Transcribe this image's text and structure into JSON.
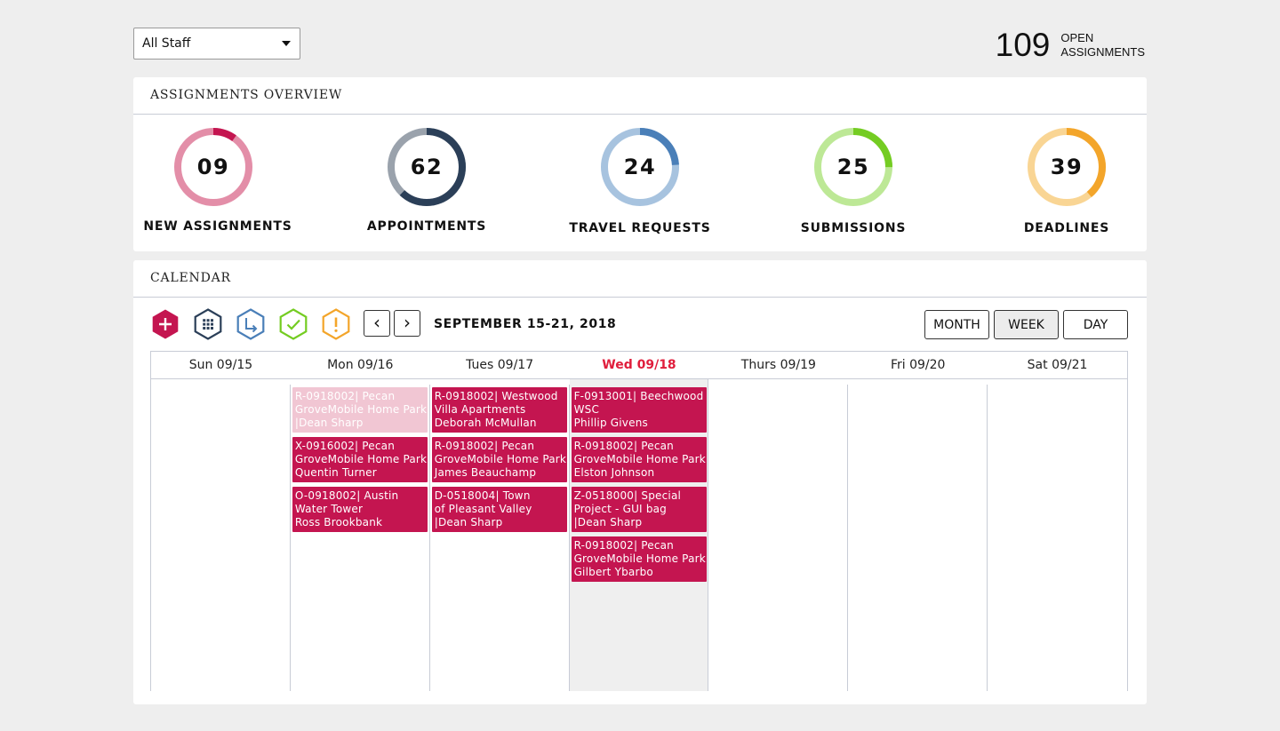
{
  "filter": {
    "selected": "All Staff"
  },
  "open_assignments": {
    "count": "109",
    "label_line1": "OPEN",
    "label_line2": "ASSIGNMENTS"
  },
  "overview": {
    "title": "ASSIGNMENTS OVERVIEW",
    "stats": [
      {
        "value": "09",
        "label": "NEW ASSIGNMENTS",
        "fraction": 0.1,
        "color": "#c41550",
        "track": "#e38ea8"
      },
      {
        "value": "62",
        "label": "APPOINTMENTS",
        "fraction": 0.62,
        "color": "#2b3f58",
        "track": "#9aa2ac"
      },
      {
        "value": "24",
        "label": "TRAVEL REQUESTS",
        "fraction": 0.24,
        "color": "#4a7fb8",
        "track": "#a7c3df"
      },
      {
        "value": "25",
        "label": "SUBMISSIONS",
        "fraction": 0.25,
        "color": "#74cc22",
        "track": "#bde896"
      },
      {
        "value": "39",
        "label": "DEADLINES",
        "fraction": 0.39,
        "color": "#f3a52a",
        "track": "#f9d594"
      }
    ]
  },
  "calendar": {
    "title": "CALENDAR",
    "tools": [
      {
        "icon": "add-icon",
        "color": "#c41550"
      },
      {
        "icon": "grid-icon",
        "color": "#2b3f58"
      },
      {
        "icon": "redirect-arrow-icon",
        "color": "#4a7fb8"
      },
      {
        "icon": "check-icon",
        "color": "#74cc22"
      },
      {
        "icon": "alert-icon",
        "color": "#f3a52a"
      }
    ],
    "prev": "‹",
    "next": "›",
    "range": "SEPTEMBER 15-21, 2018",
    "views": [
      "MONTH",
      "WEEK",
      "DAY"
    ],
    "active_view": "WEEK",
    "days": [
      "Sun 09/15",
      "Mon 09/16",
      "Tues 09/17",
      "Wed 09/18",
      "Thurs 09/19",
      "Fri 09/20",
      "Sat 09/21"
    ],
    "today_index": 3,
    "events": [
      [],
      [
        {
          "line1": "R-0918002| Pecan",
          "line2": "GroveMobile Home Park",
          "line3": "|Dean Sharp",
          "faded": true
        },
        {
          "line1": "X-0916002| Pecan",
          "line2": "GroveMobile Home Park",
          "line3": "Quentin Turner",
          "faded": false
        },
        {
          "line1": "O-0918002| Austin",
          "line2": "Water Tower",
          "line3": "Ross Brookbank",
          "faded": false
        }
      ],
      [
        {
          "line1": "R-0918002| Westwood",
          "line2": "Villa Apartments",
          "line3": "Deborah McMullan",
          "faded": false
        },
        {
          "line1": "R-0918002| Pecan",
          "line2": "GroveMobile Home Park",
          "line3": "James Beauchamp",
          "faded": false
        },
        {
          "line1": "D-0518004| Town",
          "line2": "of Pleasant Valley",
          "line3": "|Dean Sharp",
          "faded": false
        }
      ],
      [
        {
          "line1": "F-0913001| Beechwood",
          "line2": "WSC",
          "line3": "Phillip Givens",
          "faded": false
        },
        {
          "line1": "R-0918002| Pecan",
          "line2": "GroveMobile Home Park",
          "line3": "Elston Johnson",
          "faded": false
        },
        {
          "line1": "Z-0518000| Special",
          "line2": "Project - GUI bag",
          "line3": "|Dean Sharp",
          "faded": false
        },
        {
          "line1": "R-0918002| Pecan",
          "line2": "GroveMobile Home Park",
          "line3": "Gilbert Ybarbo",
          "faded": false
        }
      ],
      [],
      [],
      []
    ]
  }
}
